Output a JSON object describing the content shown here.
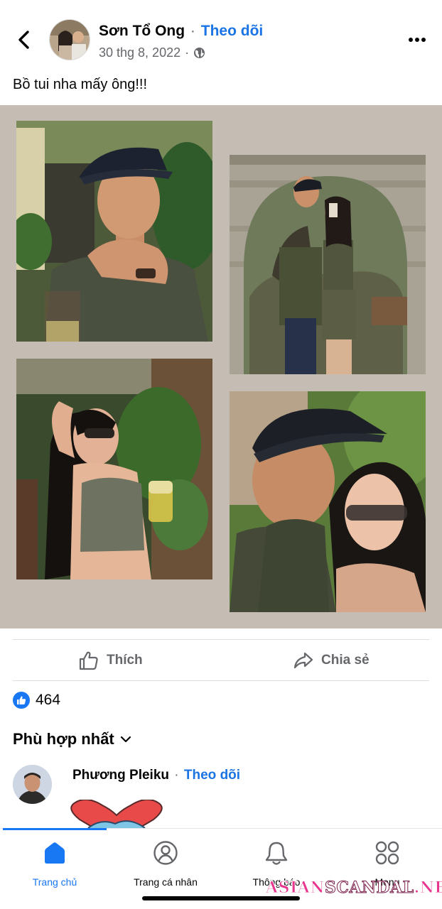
{
  "post": {
    "author_name": "Sơn Tổ Ong",
    "follow_label": "Theo dõi",
    "date": "30 thg 8, 2022",
    "privacy_icon": "globe-icon",
    "caption": "Bồ tui nha mấy ông!!!"
  },
  "actions": {
    "like_label": "Thích",
    "share_label": "Chia sẻ"
  },
  "reactions": {
    "count": "464"
  },
  "comments": {
    "sort_label": "Phù hợp nhất",
    "first_comment": {
      "author_name": "Phương Pleiku",
      "follow_label": "Theo dõi"
    }
  },
  "tabbar": {
    "items": [
      {
        "label": "Trang chủ",
        "icon": "home-icon",
        "active": true
      },
      {
        "label": "Trang cá nhân",
        "icon": "profile-icon",
        "active": false
      },
      {
        "label": "Thông báo",
        "icon": "bell-icon",
        "active": false
      },
      {
        "label": "Menu",
        "icon": "menu-grid-icon",
        "active": false
      }
    ]
  },
  "watermark": {
    "part1": "ASIAN",
    "part2": "SCANDAL",
    "part3": ".NET"
  },
  "colors": {
    "accent": "#1877f2",
    "follow_link": "#1b74e4",
    "secondary_text": "#65676b",
    "photo_backdrop": "#c5bdb4"
  }
}
